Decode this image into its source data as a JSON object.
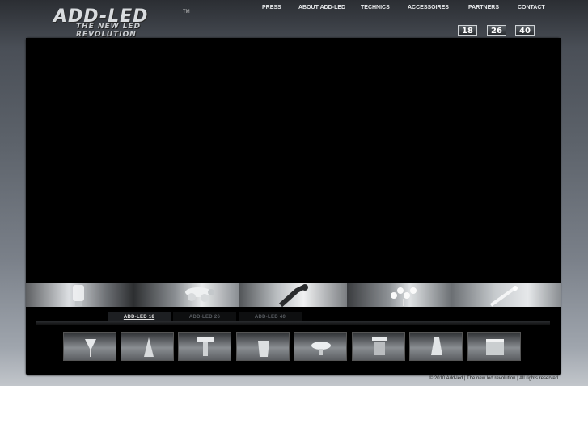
{
  "logo": {
    "main": "ADD-LED",
    "tm": "TM",
    "tagline": "THE NEW LED REVOLUTION"
  },
  "nav": {
    "items": [
      "PRESS",
      "ABOUT ADD-LED",
      "TECHNICS",
      "ACCESSOIRES",
      "PARTNERS",
      "CONTACT"
    ]
  },
  "size_buttons": [
    "18",
    "26",
    "40"
  ],
  "tabs": [
    {
      "label": "ADD-LED 18",
      "state": "active"
    },
    {
      "label": "ADD-LED 26",
      "state": "idle"
    },
    {
      "label": "ADD-LED 40",
      "state": "idle"
    }
  ],
  "gallery": {
    "items": [
      "lamp-tube-icon",
      "lamp-cluster-icon",
      "lamp-arm-icon",
      "lamp-chandelier-icon",
      "lamp-spot-icon"
    ]
  },
  "thumbnails": {
    "items": [
      "thumb-product-1",
      "thumb-product-2",
      "thumb-product-3",
      "thumb-product-4",
      "thumb-product-5",
      "thumb-product-6",
      "thumb-product-7",
      "thumb-product-8"
    ]
  },
  "footer": {
    "text": "© 2010 Add-led | The new led revolution | All rights reserved"
  },
  "colors": {
    "stage": "#000000",
    "active_tab": "#1d1f22",
    "nav_text": "#e8eaec"
  }
}
